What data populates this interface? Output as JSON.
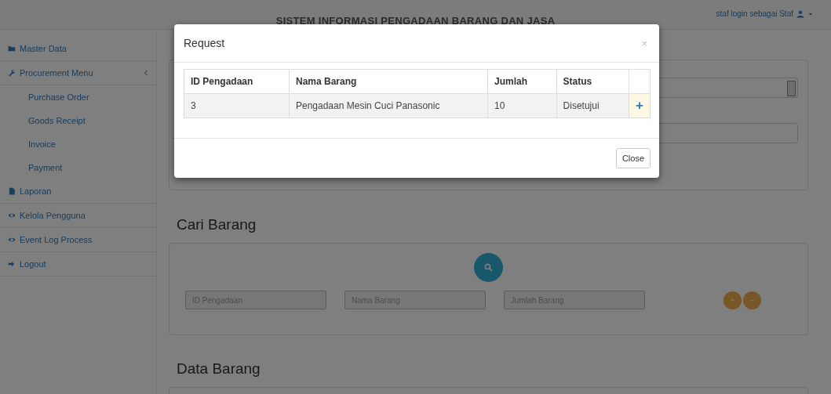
{
  "navbar": {
    "title": "SISTEM INFORMASI PENGADAAN BARANG DAN JASA",
    "user_menu": "staf login sebagai Staf"
  },
  "sidebar": {
    "items": [
      {
        "label": "Master Data",
        "kind": "folder"
      },
      {
        "label": "Procurement Menu",
        "kind": "wrench",
        "expanded": true,
        "children": [
          {
            "label": "Purchase Order"
          },
          {
            "label": "Goods Receipt"
          },
          {
            "label": "Invoice"
          },
          {
            "label": "Payment"
          }
        ]
      },
      {
        "label": "Laporan",
        "kind": "file"
      },
      {
        "label": "Kelola Pengguna",
        "kind": "eye"
      },
      {
        "label": "Event Log Process",
        "kind": "eye"
      },
      {
        "label": "Logout",
        "kind": "login"
      }
    ]
  },
  "search_section": {
    "heading": "Cari Barang",
    "fields": [
      {
        "placeholder": "ID Pengadaan"
      },
      {
        "placeholder": "Nama Barang"
      },
      {
        "placeholder": "Jumlah Barang"
      }
    ]
  },
  "data_section": {
    "heading": "Data Barang"
  },
  "modal": {
    "title": "Request",
    "close": "×",
    "table": {
      "columns": [
        "ID Pengadaan",
        "Nama Barang",
        "Jumlah",
        "Status"
      ],
      "rows": [
        {
          "cells": [
            "3",
            "Pengadaan Mesin Cuci Panasonic",
            "10",
            "Disetujui"
          ],
          "action": "+"
        }
      ]
    },
    "buttons": [
      "Close"
    ]
  }
}
